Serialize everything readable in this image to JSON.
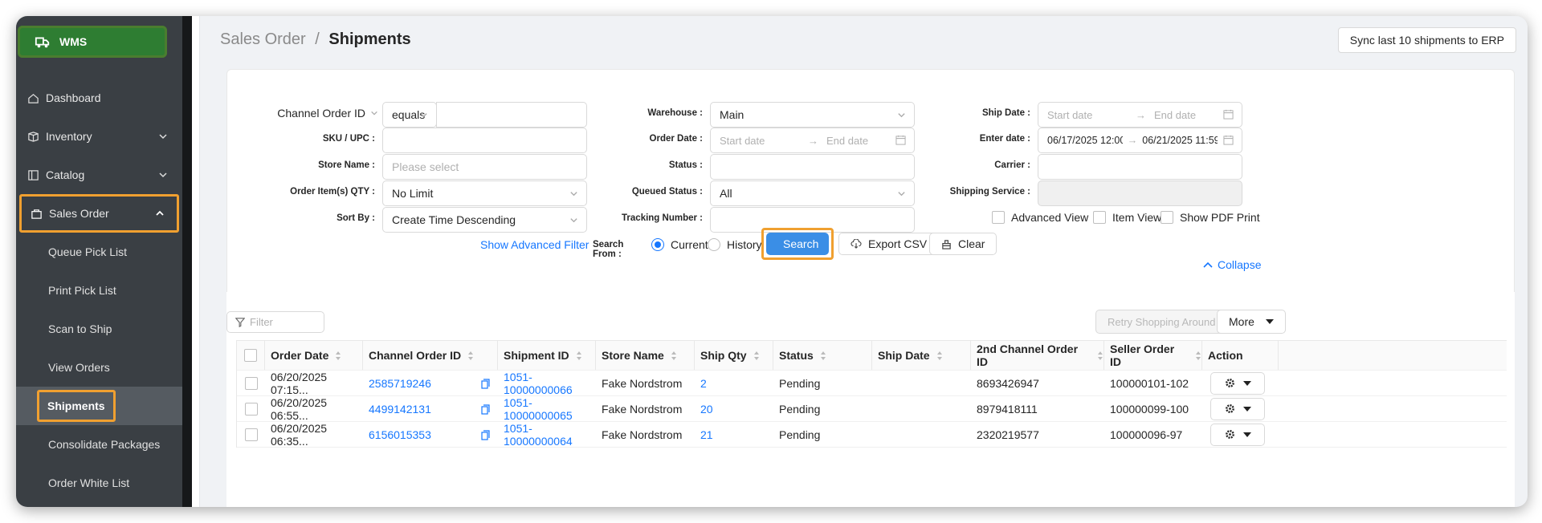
{
  "app": {
    "name": "WMS"
  },
  "sidebar": {
    "items": [
      {
        "label": "Dashboard"
      },
      {
        "label": "Inventory"
      },
      {
        "label": "Catalog"
      },
      {
        "label": "Sales Order"
      }
    ],
    "sub_items": [
      {
        "label": "Queue Pick List"
      },
      {
        "label": "Print Pick List"
      },
      {
        "label": "Scan to Ship"
      },
      {
        "label": "View Orders"
      },
      {
        "label": "Shipments"
      },
      {
        "label": "Consolidate Packages"
      },
      {
        "label": "Order White List"
      }
    ]
  },
  "header": {
    "breadcrumb_parent": "Sales Order",
    "separator": "/",
    "title": "Shipments",
    "sync_button": "Sync last 10 shipments to ERP"
  },
  "filters": {
    "channel_order_id_label": "Channel Order ID",
    "channel_order_op": "equals",
    "sku_label": "SKU / UPC :",
    "store_name_label": "Store Name :",
    "store_name_placeholder": "Please select",
    "qty_label": "Order Item(s) QTY :",
    "qty_value": "No Limit",
    "sort_label": "Sort By :",
    "sort_value": "Create Time Descending",
    "warehouse_label": "Warehouse :",
    "warehouse_value": "Main",
    "order_date_label": "Order Date :",
    "start_date_ph": "Start date",
    "end_date_ph": "End date",
    "arrow": "→",
    "status_label": "Status :",
    "queued_status_label": "Queued Status :",
    "queued_status_value": "All",
    "tracking_label": "Tracking Number :",
    "ship_date_label": "Ship Date :",
    "enter_date_label": "Enter date :",
    "enter_date_start": "06/17/2025 12:00:0",
    "enter_date_end": "06/21/2025 11:59:5",
    "carrier_label": "Carrier :",
    "shipping_service_label": "Shipping Service :",
    "advanced_view": "Advanced View",
    "item_view": "Item View",
    "show_pdf_print": "Show PDF Print",
    "show_advanced_filter": "Show Advanced Filter",
    "search_from_label": "Search From :",
    "current": "Current",
    "history": "History",
    "search": "Search",
    "export_csv": "Export CSV",
    "clear": "Clear",
    "collapse": "Collapse"
  },
  "table": {
    "filter_placeholder": "Filter",
    "retry_button": "Retry Shopping Around",
    "more_button": "More",
    "columns": [
      "Order Date",
      "Channel Order ID",
      "Shipment ID",
      "Store Name",
      "Ship Qty",
      "Status",
      "Ship Date",
      "2nd Channel Order ID",
      "Seller Order ID",
      "Action"
    ],
    "rows": [
      {
        "order_date": "06/20/2025 07:15...",
        "channel_order_id": "2585719246",
        "shipment_id": "1051-10000000066",
        "store_name": "Fake Nordstrom",
        "ship_qty": "2",
        "status": "Pending",
        "ship_date": "",
        "second_channel_id": "8693426947",
        "seller_order_id": "100000101-102"
      },
      {
        "order_date": "06/20/2025 06:55...",
        "channel_order_id": "4499142131",
        "shipment_id": "1051-10000000065",
        "store_name": "Fake Nordstrom",
        "ship_qty": "20",
        "status": "Pending",
        "ship_date": "",
        "second_channel_id": "8979418111",
        "seller_order_id": "100000099-100"
      },
      {
        "order_date": "06/20/2025 06:35...",
        "channel_order_id": "6156015353",
        "shipment_id": "1051-10000000064",
        "store_name": "Fake Nordstrom",
        "ship_qty": "21",
        "status": "Pending",
        "ship_date": "",
        "second_channel_id": "2320219577",
        "seller_order_id": "100000096-97"
      }
    ]
  },
  "colors": {
    "accent": "#1677ff",
    "primary_button": "#3a8ee6",
    "sidebar": "#3a3f44",
    "highlight": "#f0a030",
    "logo_bg": "#2e7d32"
  }
}
